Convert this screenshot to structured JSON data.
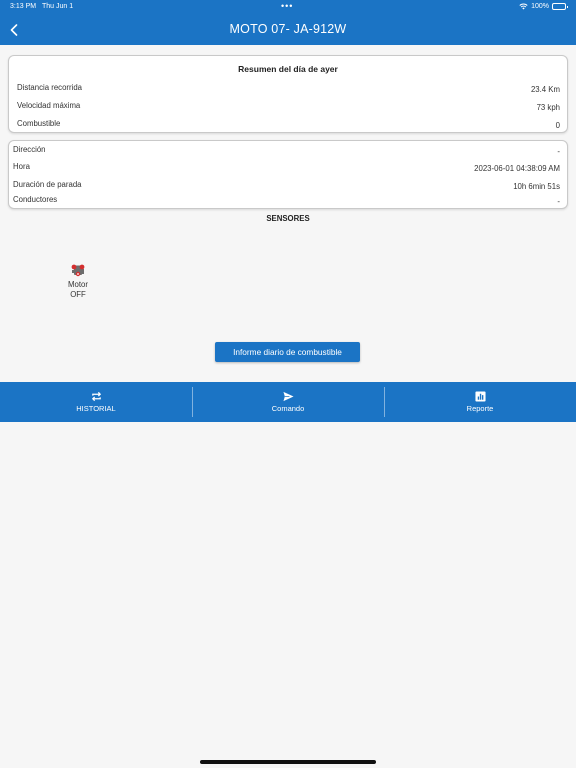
{
  "status_bar": {
    "time": "3:13 PM",
    "date": "Thu Jun 1",
    "dots": "•••",
    "battery": "100%"
  },
  "header": {
    "title": "MOTO 07- JA-912W"
  },
  "summary": {
    "title": "Resumen del día de ayer",
    "rows": [
      {
        "label": "Distancia recorrida",
        "value": "23.4 Km"
      },
      {
        "label": "Velocidad máxima",
        "value": "73 kph"
      },
      {
        "label": "Combustible",
        "value": "0"
      }
    ]
  },
  "details": {
    "rows": [
      {
        "label": "Dirección",
        "value": "-"
      },
      {
        "label": "Hora",
        "value": "2023-06-01 04:38:09 AM"
      },
      {
        "label": "Duración de parada",
        "value": "10h 6min 51s"
      },
      {
        "label": "Conductores",
        "value": "-"
      }
    ]
  },
  "sensors": {
    "title": "SENSORES",
    "items": [
      {
        "name": "Motor",
        "state": "OFF",
        "icon": "engine-icon"
      }
    ]
  },
  "fuel_button": {
    "label": "Informe diario de combustible"
  },
  "bottom_nav": [
    {
      "label": "HISTORIAL",
      "icon": "repeat-icon"
    },
    {
      "label": "Comando",
      "icon": "send-icon"
    },
    {
      "label": "Reporte",
      "icon": "chart-icon"
    }
  ],
  "colors": {
    "primary": "#1b74c5",
    "background": "#f6f6f6"
  }
}
